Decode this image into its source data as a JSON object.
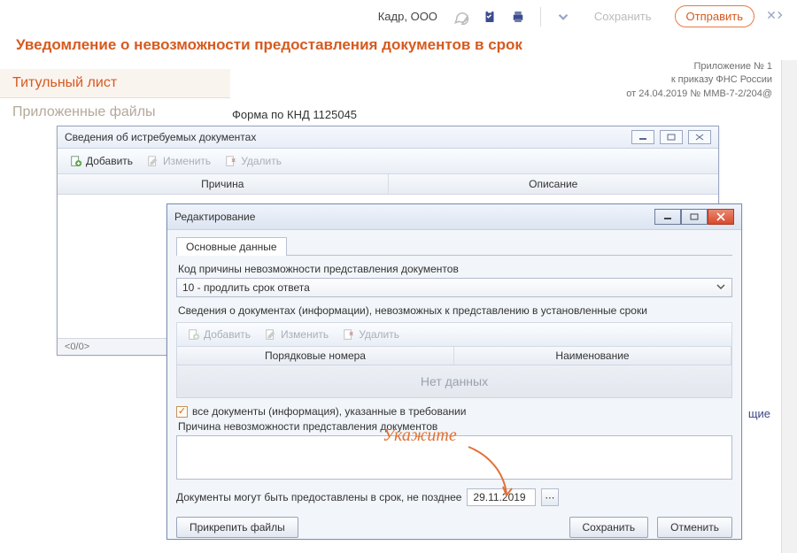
{
  "topbar": {
    "company": "Кадр, ООО",
    "save": "Сохранить",
    "send": "Отправить"
  },
  "main": {
    "title": "Уведомление о невозможности предоставления документов в срок",
    "tab_active": "Титульный лист",
    "tab_inactive": "Приложенные файлы",
    "knd": "Форма по КНД 1125045",
    "appendix_line1": "Приложение № 1",
    "appendix_line2": "к приказу ФНС России",
    "appendix_line3": "от 24.04.2019 № ММВ-7-2/204@"
  },
  "docs_window": {
    "title": "Сведения об истребуемых документах",
    "add": "Добавить",
    "edit": "Изменить",
    "del": "Удалить",
    "col_reason": "Причина",
    "col_desc": "Описание",
    "status": "<0/0>"
  },
  "edit_window": {
    "title": "Редактирование",
    "tab1": "Основные данные",
    "label_code": "Код причины невозможности представления документов",
    "code_value": "10 - продлить срок ответа",
    "label_docs_info": "Сведения о документах (информации), невозможных к представлению в установленные сроки",
    "add": "Добавить",
    "edit": "Изменить",
    "del": "Удалить",
    "col_numbers": "Порядковые номера",
    "col_name": "Наименование",
    "no_data": "Нет данных",
    "checkbox_text": "все документы (информация), указанные в требовании",
    "reason_label": "Причина невозможности представления документов",
    "date_label": "Документы могут быть предоставлены в срок, не позднее",
    "date_value": "29.11.2019",
    "attach": "Прикрепить файлы",
    "save": "Сохранить",
    "cancel": "Отменить"
  },
  "annotation": "Укажите",
  "bg_peek2": "щие"
}
